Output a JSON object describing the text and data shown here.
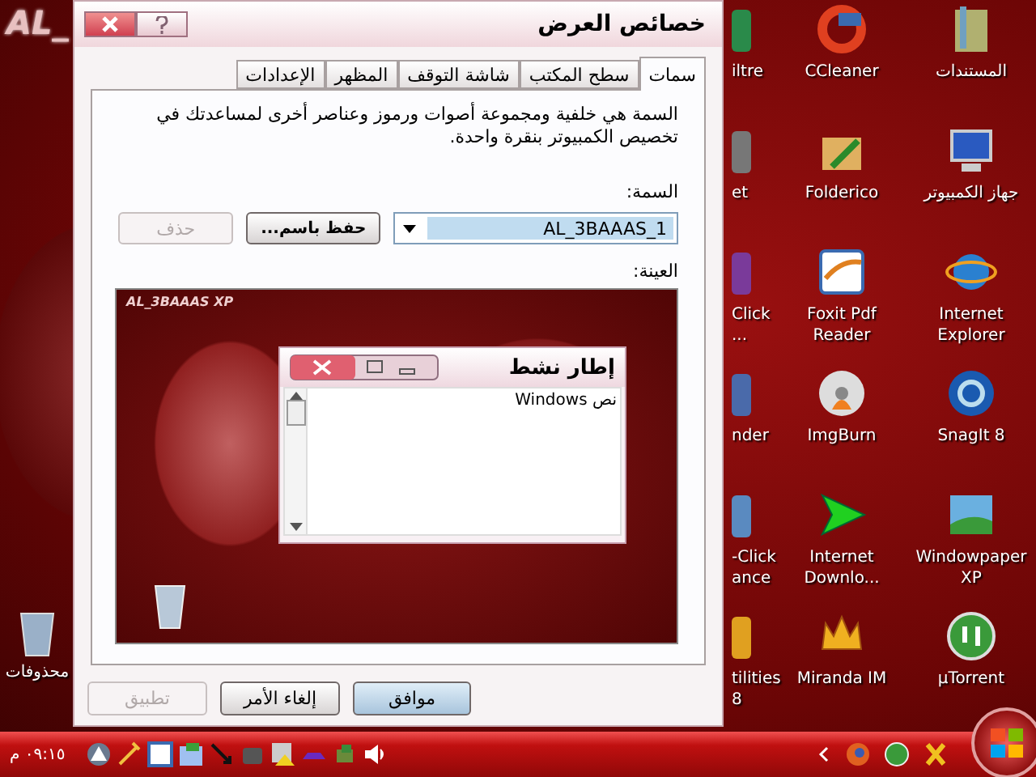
{
  "desktop": {
    "logo": "AL_",
    "recycle_bin": {
      "label": "محذوفات"
    },
    "icon_columns": [
      {
        "kind": "full",
        "items": [
          {
            "label": "المستندات"
          },
          {
            "label": "جهاز الكمبيوتر"
          },
          {
            "label": "Internet\nExplorer"
          },
          {
            "label": "SnagIt 8"
          },
          {
            "label": "Windowpaper\nXP"
          },
          {
            "label": "µTorrent"
          }
        ]
      },
      {
        "kind": "full",
        "items": [
          {
            "label": "CCleaner"
          },
          {
            "label": "Folderico"
          },
          {
            "label": "Foxit Pdf\nReader"
          },
          {
            "label": "ImgBurn"
          },
          {
            "label": "Internet\nDownlo..."
          },
          {
            "label": "Miranda IM"
          }
        ]
      },
      {
        "kind": "partial",
        "items": [
          {
            "label": "iltre"
          },
          {
            "label": "et"
          },
          {
            "label": "Click\n..."
          },
          {
            "label": "nder"
          },
          {
            "label": "-Click\nance"
          },
          {
            "label": "tilities\n8"
          }
        ]
      }
    ]
  },
  "dialog": {
    "title": "خصائص العرض",
    "tabs": [
      {
        "label": "سمات",
        "selected": true
      },
      {
        "label": "سطح المكتب",
        "selected": false
      },
      {
        "label": "شاشة التوقف",
        "selected": false
      },
      {
        "label": "المظهر",
        "selected": false
      },
      {
        "label": "الإعدادات",
        "selected": false
      }
    ],
    "description": "السمة هي خلفية ومجموعة أصوات ورموز وعناصر أخرى لمساعدتك في تخصيص الكمبيوتر بنقرة واحدة.",
    "theme_label": "السمة:",
    "theme_value": "AL_3BAAAS_1",
    "theme_buttons": [
      {
        "label": "حفظ باسم...",
        "disabled": false
      },
      {
        "label": "حذف",
        "disabled": true
      }
    ],
    "sample_label": "العينة:",
    "preview": {
      "caption": "AL_3BAAAS XP",
      "window_title": "إطار نشط",
      "window_text": "نص Windows"
    },
    "buttons": [
      {
        "label": "موافق",
        "disabled": false,
        "focused": true
      },
      {
        "label": "إلغاء الأمر",
        "disabled": false,
        "focused": false
      },
      {
        "label": "تطبيق",
        "disabled": true,
        "focused": false
      }
    ]
  },
  "taskbar": {
    "clock": "٠٩:١٥ م"
  }
}
